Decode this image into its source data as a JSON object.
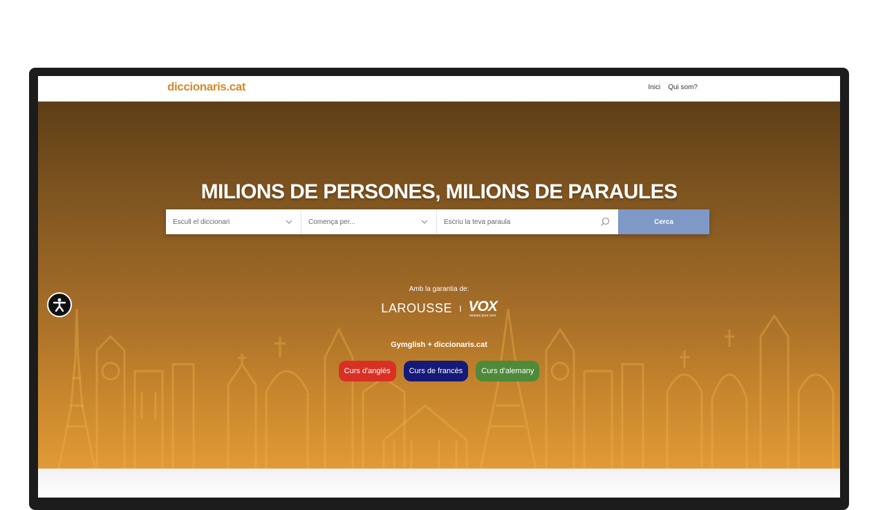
{
  "site": {
    "logo": "diccionaris.cat"
  },
  "nav": {
    "items": [
      {
        "label": "Inici"
      },
      {
        "label": "Qui som?"
      }
    ]
  },
  "hero": {
    "headline": "MILIONS DE PERSONES, MILIONS DE PARAULES",
    "search": {
      "dictionary_select": "Escull el diccionari",
      "starts_with_select": "Comença per...",
      "word_placeholder": "Escriu la teva paraula",
      "button_label": "Cerca"
    },
    "guarantee_label": "Amb la garantia de:",
    "brands": {
      "larousse": "LAROUSSE",
      "separator": "I",
      "vox": "VOX",
      "vox_tagline": "nenses pour com"
    },
    "partner_label": "Gymglish + diccionaris.cat",
    "courses": [
      {
        "label": "Curs d'anglès",
        "color": "#d93025"
      },
      {
        "label": "Curs de francès",
        "color": "#151a78"
      },
      {
        "label": "Curs d'alemany",
        "color": "#4e8a3a"
      }
    ]
  },
  "colors": {
    "brand": "#d38a2a",
    "search_button": "#7e99c8",
    "hero_top": "#5e3e17",
    "hero_bottom": "#e19a36"
  },
  "icons": {
    "accessibility": "accessibility-icon",
    "dropdown": "chevron-down-icon",
    "search": "search-icon"
  }
}
